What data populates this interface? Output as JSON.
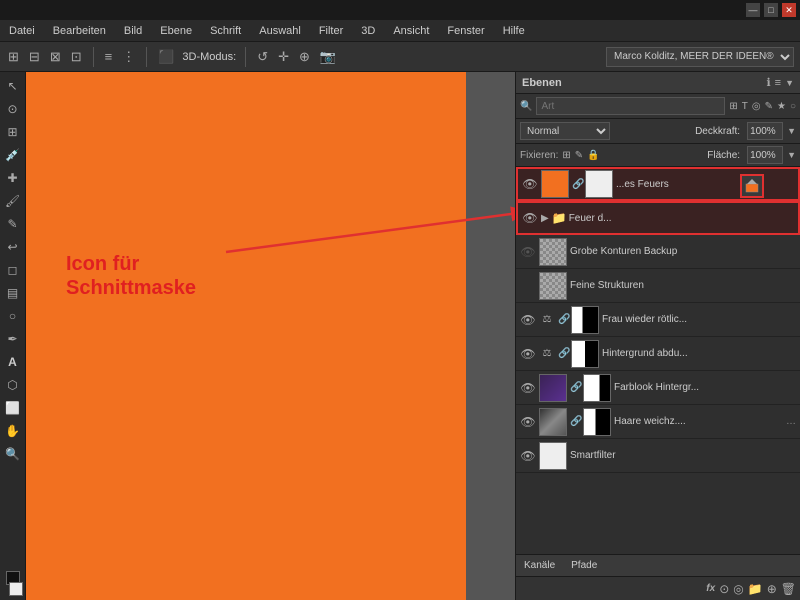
{
  "titlebar": {
    "controls": [
      "—",
      "□",
      "✕"
    ]
  },
  "menubar": {
    "items": [
      "Datei",
      "Bearbeiten",
      "Bild",
      "Ebene",
      "Schrift",
      "Auswahl",
      "Filter",
      "3D",
      "Ansicht",
      "Fenster",
      "Hilfe"
    ]
  },
  "toolbar": {
    "threeD_label": "3D-Modus:",
    "profile_name": "Marco Kolditz, MEER DER IDEEN®"
  },
  "layers_panel": {
    "title": "Ebenen",
    "search_placeholder": "Art",
    "blend_mode": "Normal",
    "opacity_label": "Deckkraft:",
    "opacity_value": "100%",
    "fill_label": "Fläche:",
    "fill_value": "100%",
    "fixieren_label": "Fixieren:",
    "layers": [
      {
        "id": "layer-feuers",
        "name": "...es Feuers",
        "type": "smart",
        "has_mask": true,
        "mask_white": true,
        "has_clip": true,
        "visible": true,
        "is_group_child": true
      },
      {
        "id": "layer-feuer-d",
        "name": "Feuer d...",
        "type": "group",
        "visible": true,
        "is_group": true
      },
      {
        "id": "layer-grobe",
        "name": "Grobe Konturen Backup",
        "type": "layer",
        "visible": false
      },
      {
        "id": "layer-feine",
        "name": "Feine Strukturen",
        "type": "layer",
        "visible": false
      },
      {
        "id": "layer-frau",
        "name": "Frau wieder rötlic...",
        "type": "smart",
        "has_mask": true,
        "visible": true
      },
      {
        "id": "layer-hintergrund",
        "name": "Hintergrund abdu...",
        "type": "smart",
        "has_mask": true,
        "visible": true
      },
      {
        "id": "layer-farblook",
        "name": "Farblook Hintergr...",
        "type": "smart",
        "has_mask": true,
        "visible": true
      },
      {
        "id": "layer-haare",
        "name": "Haare weichz....",
        "type": "smart",
        "has_mask": true,
        "visible": true
      },
      {
        "id": "layer-smartfilter",
        "name": "Smartfilter",
        "type": "layer",
        "visible": true
      }
    ],
    "bottom_tabs": [
      "Kanäle",
      "Pfade"
    ],
    "footer_icons": [
      "fx",
      "●",
      "◎",
      "⊕",
      "📁",
      "🗑"
    ]
  },
  "annotation": {
    "line1": "Icon für",
    "line2": "Schnittmaske"
  },
  "icons": {
    "eye": "👁",
    "link": "🔗",
    "folder": "📁",
    "search": "🔍",
    "settings": "⚙"
  }
}
